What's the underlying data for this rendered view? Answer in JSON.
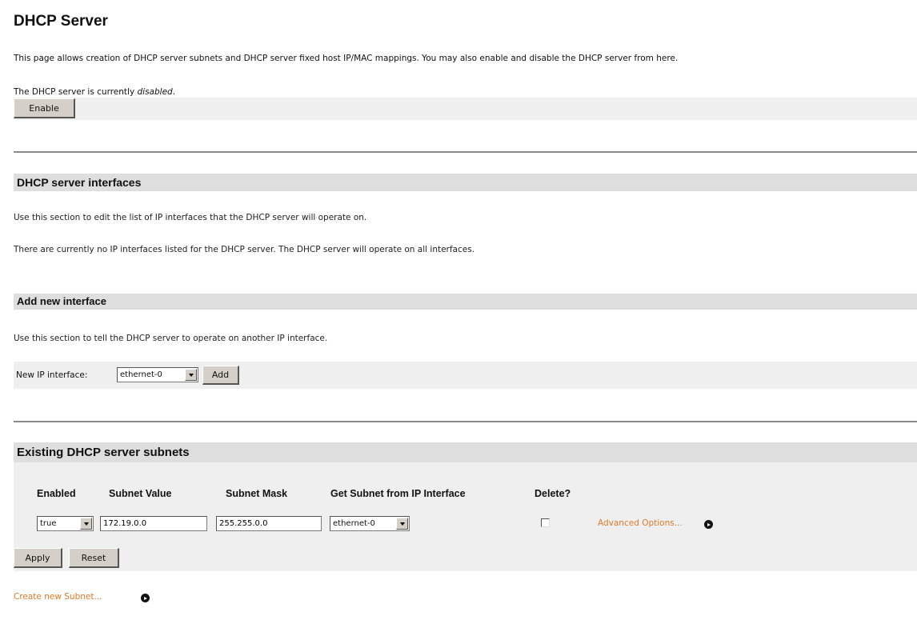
{
  "page": {
    "title": "DHCP Server",
    "intro": "This page allows creation of DHCP server subnets and DHCP server fixed host IP/MAC mappings. You may also enable and disable the DHCP server from here."
  },
  "status": {
    "text_prefix": "The DHCP server is currently ",
    "state": "disabled",
    "text_suffix": ".",
    "enable_label": "Enable"
  },
  "interfaces": {
    "heading": "DHCP server interfaces",
    "description": "Use this section to edit the list of IP interfaces that the DHCP server will operate on.",
    "empty_message": "There are currently no IP interfaces listed for the DHCP server. The DHCP server will operate on all interfaces."
  },
  "add_interface": {
    "heading": "Add new interface",
    "description": "Use this section to tell the DHCP server to operate on another IP interface.",
    "field_label": "New IP interface:",
    "selected": "ethernet-0",
    "add_label": "Add"
  },
  "subnets": {
    "heading": "Existing DHCP server subnets",
    "columns": [
      "Enabled",
      "Subnet Value",
      "Subnet Mask",
      "Get Subnet from IP Interface",
      "Delete?"
    ],
    "rows": [
      {
        "enabled": "true",
        "subnet_value": "172.19.0.0",
        "subnet_mask": "255.255.0.0",
        "interface": "ethernet-0",
        "delete": false,
        "advanced_label": "Advanced Options..."
      }
    ],
    "apply_label": "Apply",
    "reset_label": "Reset",
    "create_label": "Create new Subnet..."
  },
  "icons": {
    "go": "arrow-circle-icon",
    "dropdown": "chevron-down-icon"
  },
  "colors": {
    "link": "#e07b2a",
    "section_header": "#dedede",
    "panel": "#efefef",
    "rule": "#8a8a8a"
  }
}
